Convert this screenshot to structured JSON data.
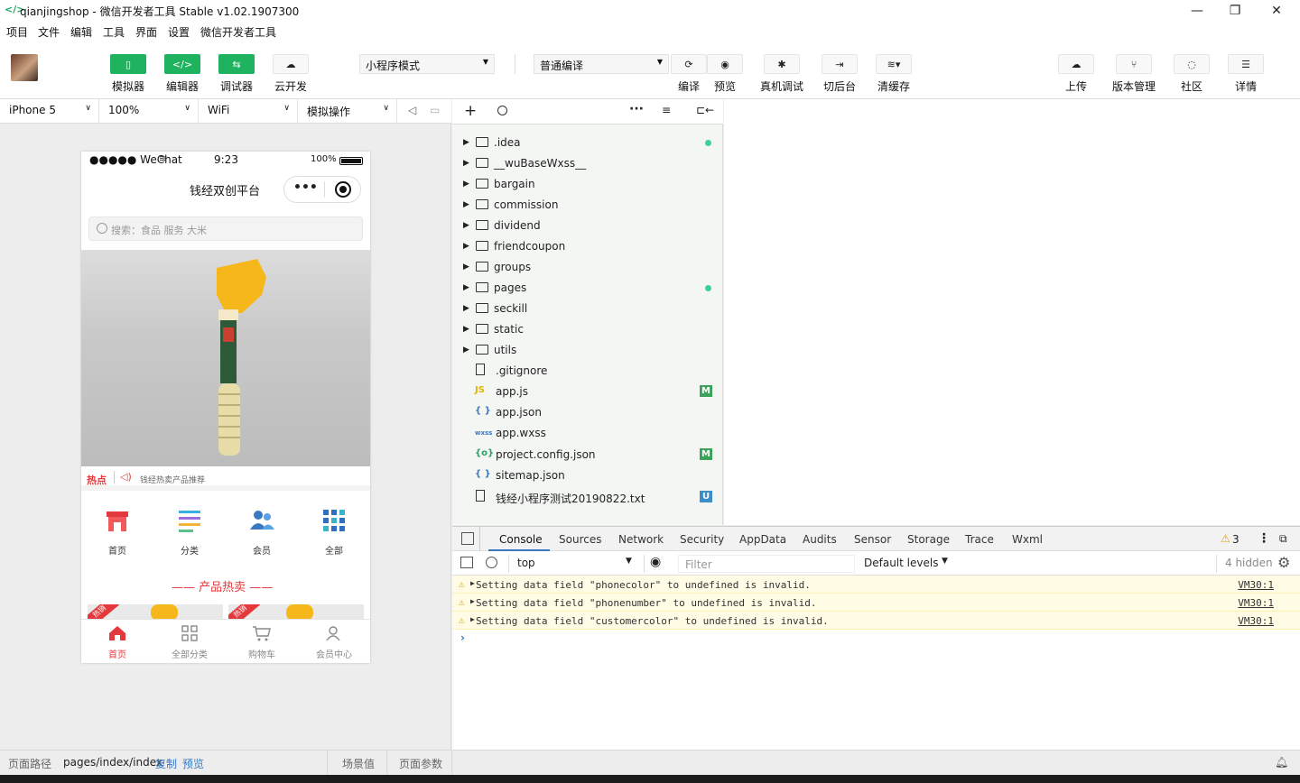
{
  "title": {
    "text": "qianjingshop - 微信开发者工具 Stable v1.02.1907300"
  },
  "menu": [
    "项目",
    "文件",
    "编辑",
    "工具",
    "界面",
    "设置",
    "微信开发者工具"
  ],
  "toolbar": {
    "simulator": "模拟器",
    "editor": "编辑器",
    "debugger": "调试器",
    "cloud": "云开发",
    "mode_select": "小程序模式",
    "compile_select": "普通编译",
    "compile": "编译",
    "preview": "预览",
    "remote_debug": "真机调试",
    "backstage": "切后台",
    "clear_cache": "清缓存",
    "upload": "上传",
    "version": "版本管理",
    "community": "社区",
    "details": "详情"
  },
  "device": {
    "model": "iPhone 5",
    "zoom": "100%",
    "network": "WiFi",
    "operation": "模拟操作"
  },
  "phone": {
    "status_carrier": "●●●●● WeChat",
    "status_time": "9:23",
    "status_battery": "100%",
    "page_title": "钱经双创平台",
    "search_placeholder": "搜索：食品 服务 大米",
    "hot_label": "热点",
    "hot_text": "钱经热卖产品推荐",
    "categories": [
      "首页",
      "分类",
      "会员",
      "全部"
    ],
    "section_title": "—— 产品热卖 ——",
    "tabs": [
      "首页",
      "全部分类",
      "购物车",
      "会员中心"
    ],
    "ribbon": "热销"
  },
  "tree": [
    {
      "name": ".idea",
      "type": "folder",
      "mark": "dot"
    },
    {
      "name": "__wuBaseWxss__",
      "type": "folder",
      "mark": ""
    },
    {
      "name": "bargain",
      "type": "folder",
      "mark": ""
    },
    {
      "name": "commission",
      "type": "folder",
      "mark": ""
    },
    {
      "name": "dividend",
      "type": "folder",
      "mark": ""
    },
    {
      "name": "friendcoupon",
      "type": "folder",
      "mark": ""
    },
    {
      "name": "groups",
      "type": "folder",
      "mark": ""
    },
    {
      "name": "pages",
      "type": "folder",
      "mark": "dot"
    },
    {
      "name": "seckill",
      "type": "folder",
      "mark": ""
    },
    {
      "name": "static",
      "type": "folder",
      "mark": ""
    },
    {
      "name": "utils",
      "type": "folder",
      "mark": ""
    },
    {
      "name": ".gitignore",
      "type": "file",
      "mark": ""
    },
    {
      "name": "app.js",
      "type": "js",
      "mark": "M"
    },
    {
      "name": "app.json",
      "type": "json",
      "mark": ""
    },
    {
      "name": "app.wxss",
      "type": "wxss",
      "mark": ""
    },
    {
      "name": "project.config.json",
      "type": "config",
      "mark": "M"
    },
    {
      "name": "sitemap.json",
      "type": "json",
      "mark": ""
    },
    {
      "name": "钱经小程序测试20190822.txt",
      "type": "file",
      "mark": "U"
    }
  ],
  "devtools": {
    "tabs": [
      "Console",
      "Sources",
      "Network",
      "Security",
      "AppData",
      "Audits",
      "Sensor",
      "Storage",
      "Trace",
      "Wxml"
    ],
    "warn_count": "3",
    "context": "top",
    "filter_placeholder": "Filter",
    "levels": "Default levels",
    "hidden": "4 hidden"
  },
  "console": [
    {
      "text": "Setting data field \"phonecolor\" to undefined is invalid.",
      "link": "VM30:1"
    },
    {
      "text": "Setting data field \"phonenumber\" to undefined is invalid.",
      "link": "VM30:1"
    },
    {
      "text": "Setting data field \"customercolor\" to undefined is invalid.",
      "link": "VM30:1"
    }
  ],
  "status": {
    "path_label": "页面路径",
    "path": "pages/index/index",
    "copy": "复制",
    "preview": "预览",
    "scene": "场景值",
    "params": "页面参数"
  },
  "colors": {
    "green": "#20b35f",
    "red": "#e4393c",
    "accent_blue": "#3a79c2"
  }
}
